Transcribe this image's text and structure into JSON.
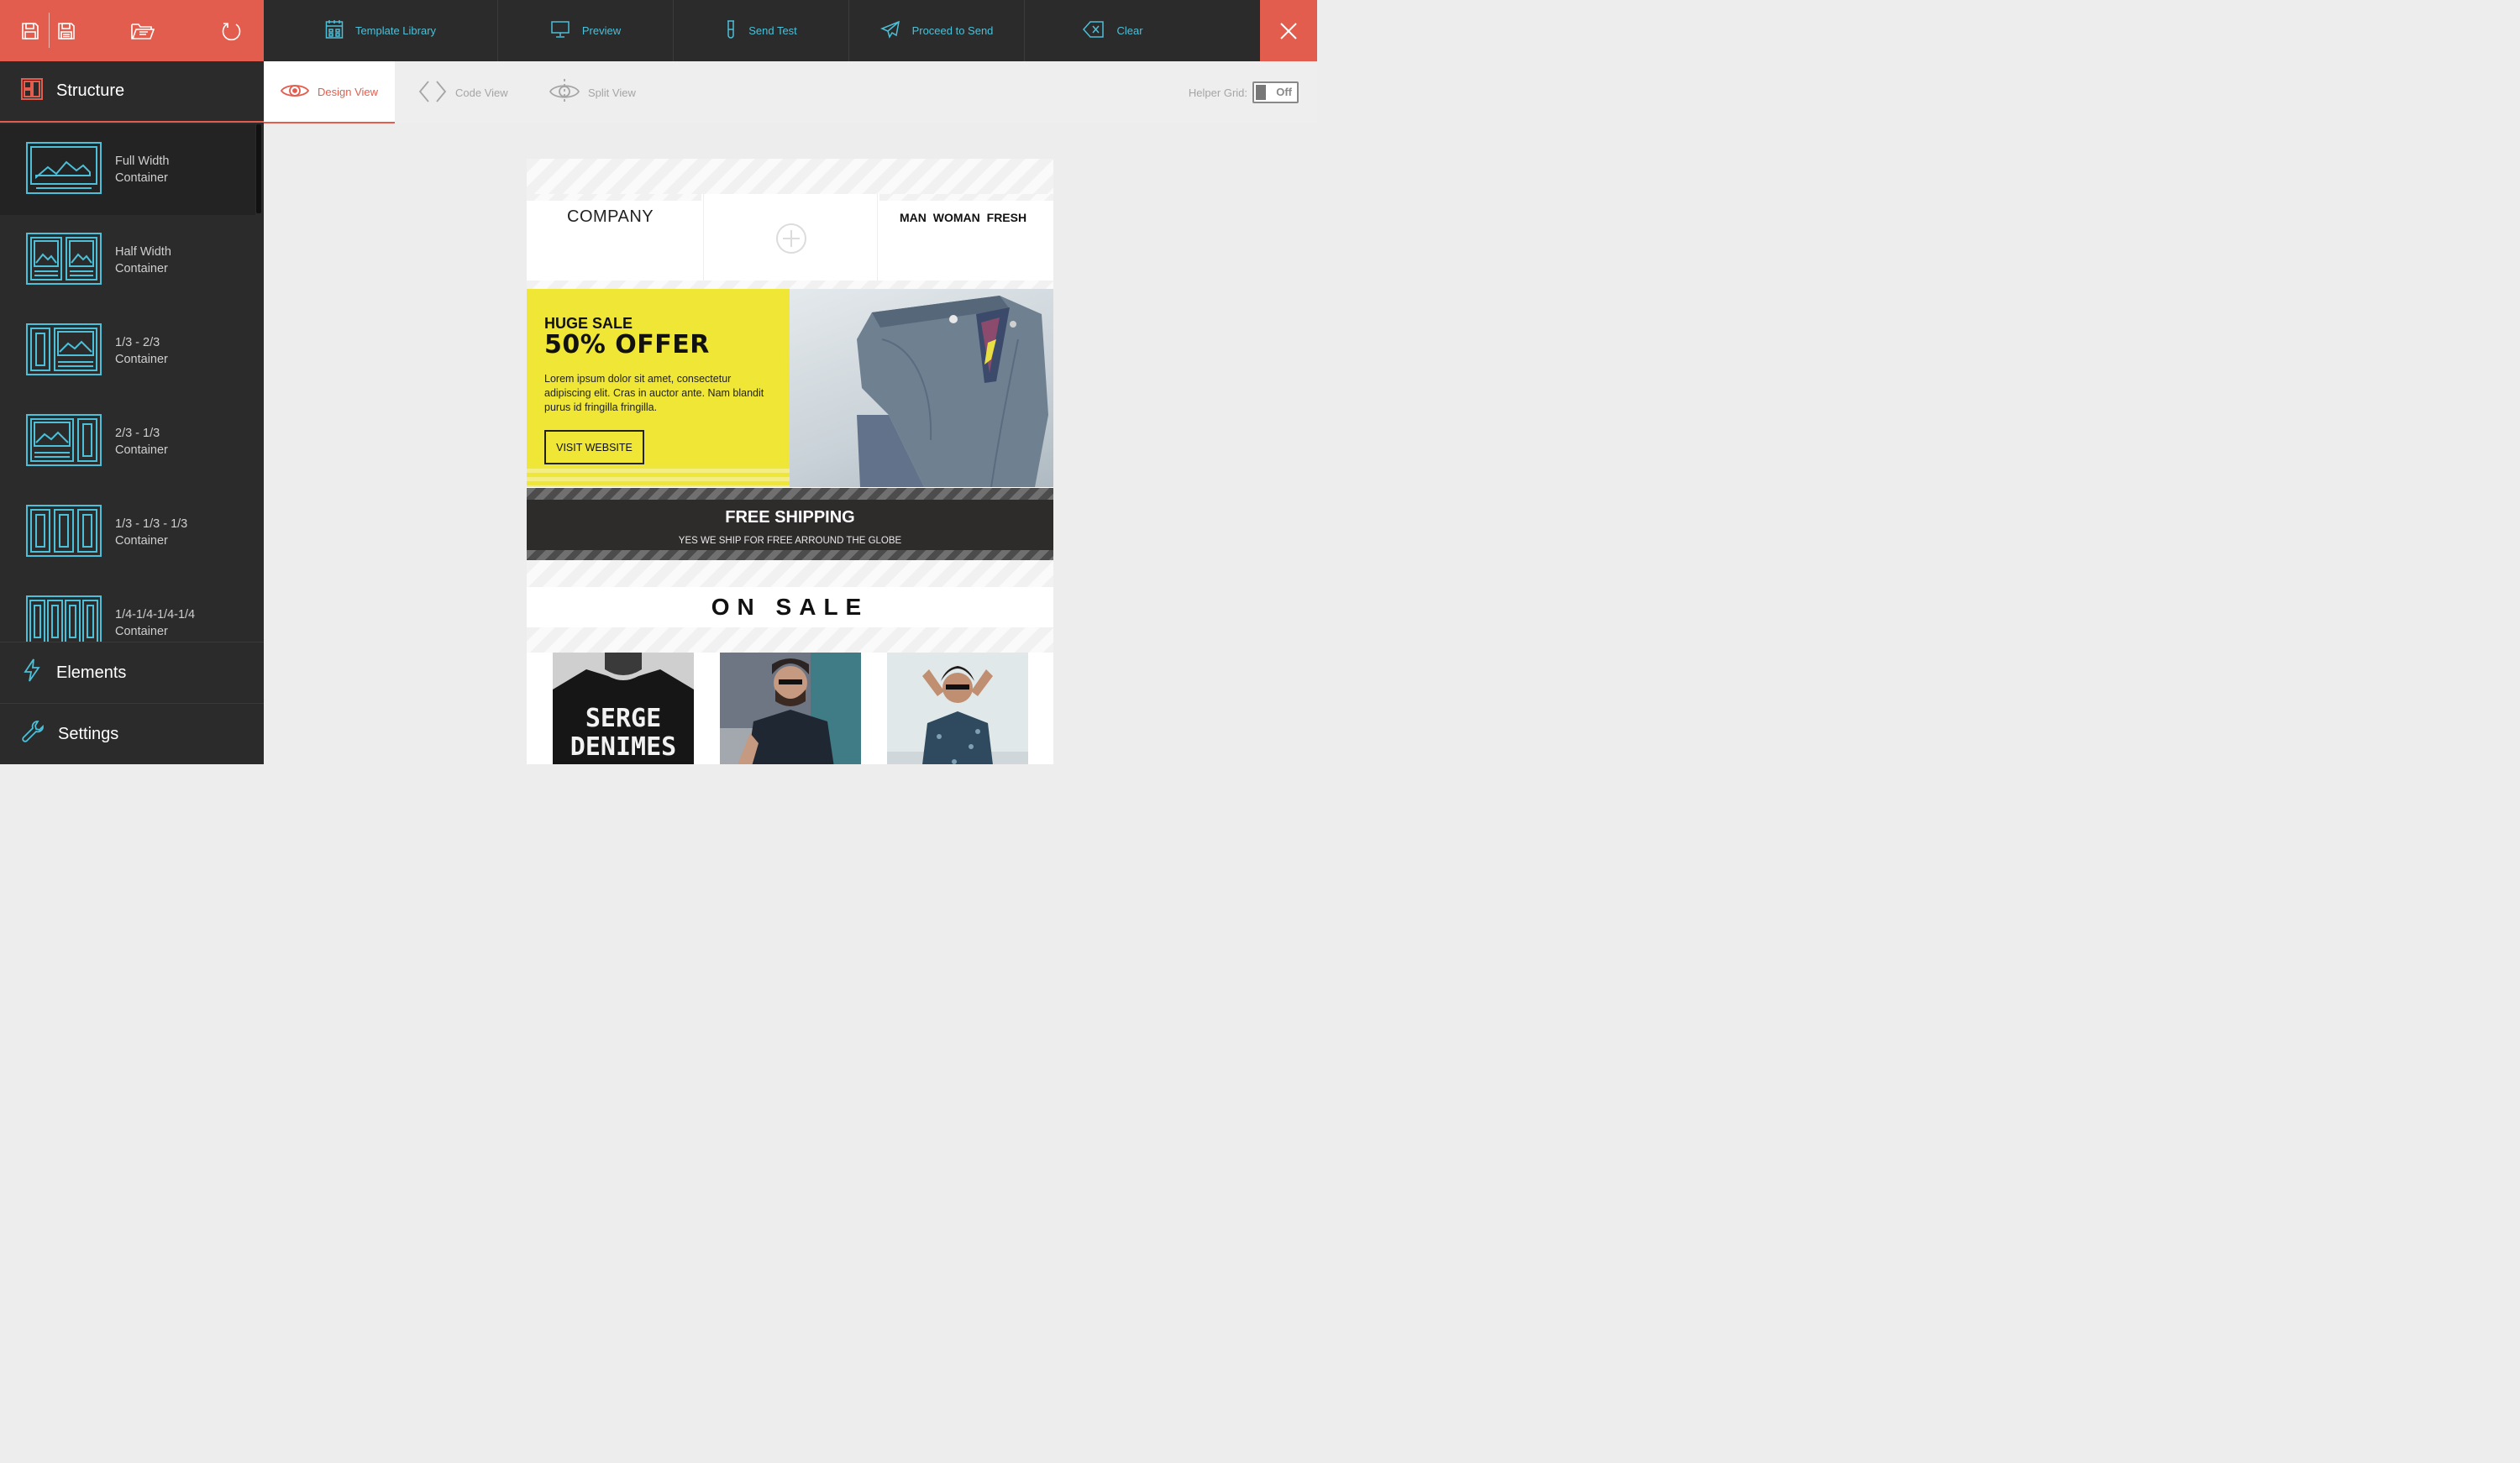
{
  "toolbar": {
    "items": [
      {
        "label": "Template Library",
        "icon": "template-library-icon"
      },
      {
        "label": "Preview",
        "icon": "preview-monitor-icon"
      },
      {
        "label": "Send Test",
        "icon": "test-tube-icon"
      },
      {
        "label": "Proceed to Send",
        "icon": "paper-plane-icon"
      },
      {
        "label": "Clear",
        "icon": "backspace-clear-icon"
      }
    ],
    "left_icons": [
      "save-icon",
      "save-as-icon",
      "open-folder-icon",
      "undo-icon"
    ],
    "close_icon": "close-icon"
  },
  "sidebar": {
    "structure_label": "Structure",
    "containers": [
      {
        "label": "Full Width\nContainer",
        "icon": "full-width-container-icon"
      },
      {
        "label": "Half Width\nContainer",
        "icon": "half-width-container-icon"
      },
      {
        "label": "1/3 - 2/3\nContainer",
        "icon": "one-third-two-thirds-container-icon"
      },
      {
        "label": "2/3 - 1/3\nContainer",
        "icon": "two-thirds-one-third-container-icon"
      },
      {
        "label": "1/3 - 1/3 - 1/3\nContainer",
        "icon": "three-column-container-icon"
      },
      {
        "label": "1/4-1/4-1/4-1/4\nContainer",
        "icon": "four-column-container-icon"
      }
    ],
    "elements_label": "Elements",
    "settings_label": "Settings"
  },
  "views": {
    "tabs": [
      {
        "label": "Design View",
        "active": true
      },
      {
        "label": "Code View",
        "active": false
      },
      {
        "label": "Split View",
        "active": false
      }
    ],
    "helper_grid_label": "Helper Grid:",
    "helper_grid_value": "Off"
  },
  "email": {
    "company": "COMPANY",
    "nav": "MAN  WOMAN  FRESH",
    "hero": {
      "kicker": "HUGE SALE",
      "headline": "50% OFFER",
      "body": "Lorem ipsum dolor sit amet, consectetur adipiscing elit. Cras in auctor ante. Nam blandit purus id fringilla fringilla.",
      "button": "VISIT WEBSITE"
    },
    "shipping": {
      "title": "FREE SHIPPING",
      "subtitle": "YES WE SHIP FOR FREE ARROUND THE GLOBE"
    },
    "sale_title": "ON SALE",
    "product_tee_text": [
      "SERGE",
      "DENIMES"
    ]
  },
  "colors": {
    "accent": "#e25d4d",
    "link": "#4cc0d8",
    "dark": "#2b2b2b",
    "yellow": "#efe635"
  }
}
